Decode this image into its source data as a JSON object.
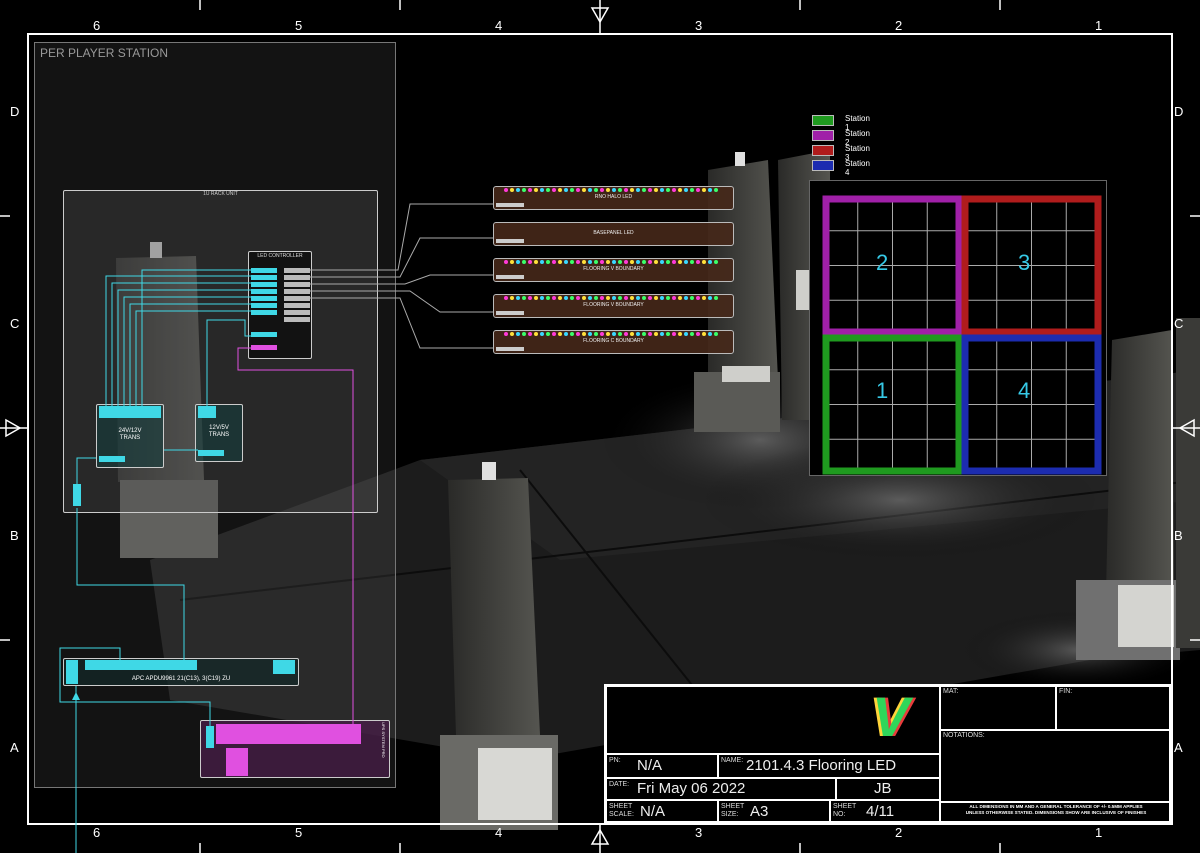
{
  "drawing": {
    "col_numbers": [
      "6",
      "5",
      "4",
      "3",
      "2",
      "1"
    ],
    "row_letters": [
      "D",
      "C",
      "B",
      "A"
    ]
  },
  "station_panel": {
    "title": "PER PLAYER STATION"
  },
  "rack": {
    "title": "1U RACK UNIT",
    "led_controller": "LED CONTROLLER",
    "psu_24v": [
      "24V/12V",
      "TRANS"
    ],
    "psu_12v": [
      "12V/5V",
      "TRANS"
    ]
  },
  "pdu": {
    "label": "APC APDU9961 21(C13), 3(C19) ZU",
    "ups_label": [
      "UPS",
      "SYSTEM",
      "PRO"
    ]
  },
  "led_strips": [
    {
      "label": "RNO HALO LED"
    },
    {
      "label": "BASEPANEL LED"
    },
    {
      "label": "FLOORING V BOUNDARY"
    },
    {
      "label": "FLOORING V BOUNDARY"
    },
    {
      "label": "FLOORING C BOUNDARY"
    }
  ],
  "legend": [
    {
      "label": "Station 1",
      "color": "#1f9a1f"
    },
    {
      "label": "Station 2",
      "color": "#a020a8"
    },
    {
      "label": "Station 3",
      "color": "#b01c1c"
    },
    {
      "label": "Station 4",
      "color": "#1c2cb0"
    }
  ],
  "floor_quadrants": [
    "2",
    "3",
    "1",
    "4"
  ],
  "title_block": {
    "pn_label": "PN:",
    "pn": "N/A",
    "name_label": "NAME:",
    "name": "2101.4.3 Flooring LED",
    "date_label": "DATE:",
    "date": "Fri May 06 2022",
    "author": "JB",
    "scale_label": [
      "SHEET",
      "SCALE:"
    ],
    "scale": "N/A",
    "size_label": [
      "SHEET",
      "SIZE:"
    ],
    "size": "A3",
    "sheet_label": [
      "SHEET",
      "NO:"
    ],
    "sheet_no": "4/11",
    "mat_label": "MAT:",
    "fin_label": "FIN:",
    "notations_label": "NOTATIONS:",
    "note_line1": "ALL DIMENSIONS IN MM AND A GENERAL TOLERANCE OF +/- 0.5MM APPLIES",
    "note_line2": "UNLESS OTHERWISE STATED. DIMENSIONS SHOW ARE INCLUSIVE OF FINISHES",
    "logo_letter": "V"
  }
}
